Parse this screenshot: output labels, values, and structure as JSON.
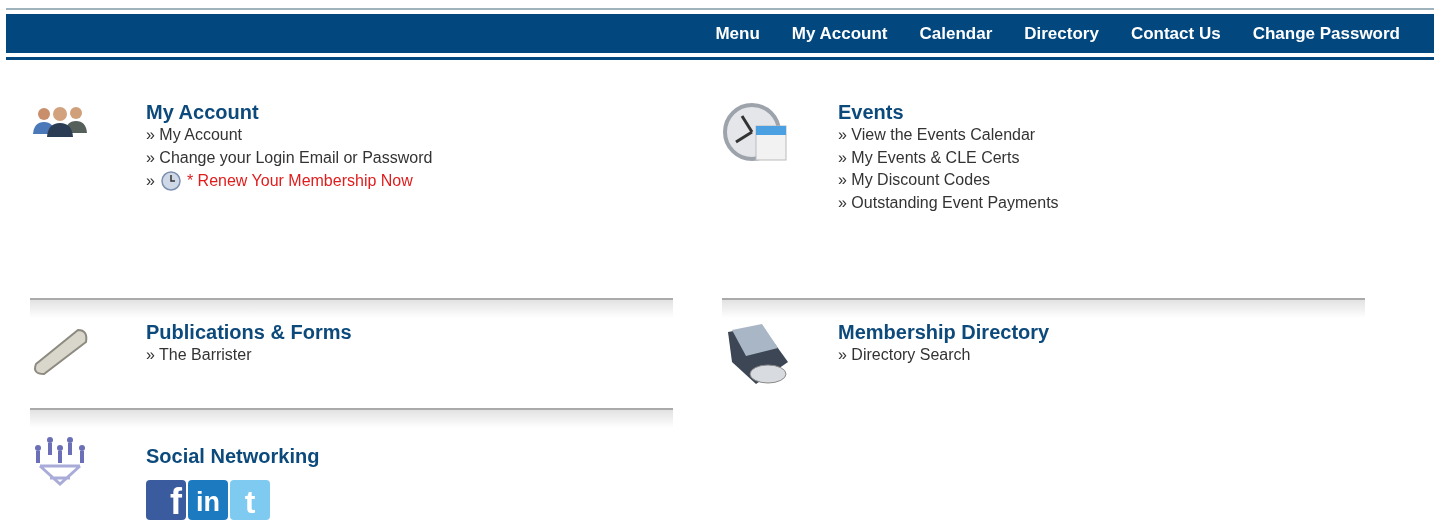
{
  "nav": [
    {
      "label": "Menu"
    },
    {
      "label": "My Account"
    },
    {
      "label": "Calendar"
    },
    {
      "label": "Directory"
    },
    {
      "label": "Contact Us"
    },
    {
      "label": "Change Password"
    }
  ],
  "columns": [
    {
      "sections": [
        {
          "title": "My Account",
          "links": [
            {
              "kind": "link",
              "text": "» My Account"
            },
            {
              "kind": "link",
              "text": "» Change your Login Email or Password"
            },
            {
              "kind": "alert",
              "prefix": "»",
              "text": "* Renew Your Membership Now"
            }
          ]
        },
        {
          "title": "Publications & Forms",
          "links": [
            {
              "kind": "link",
              "text": "» The Barrister"
            }
          ]
        },
        {
          "title": "Social Networking",
          "social": [
            {
              "kind": "facebook",
              "glyph": "f"
            },
            {
              "kind": "linkedin",
              "glyph": "in"
            },
            {
              "kind": "twitter",
              "glyph": "t"
            }
          ]
        }
      ]
    },
    {
      "sections": [
        {
          "title": "Events",
          "links": [
            {
              "kind": "link",
              "text": "» View the Events Calendar"
            },
            {
              "kind": "link",
              "text": "» My Events & CLE Certs"
            },
            {
              "kind": "link",
              "text": "» My Discount Codes"
            },
            {
              "kind": "link",
              "text": "» Outstanding Event Payments"
            }
          ]
        },
        {
          "title": "Membership Directory",
          "links": [
            {
              "kind": "link",
              "text": "» Directory Search"
            }
          ]
        }
      ]
    }
  ]
}
